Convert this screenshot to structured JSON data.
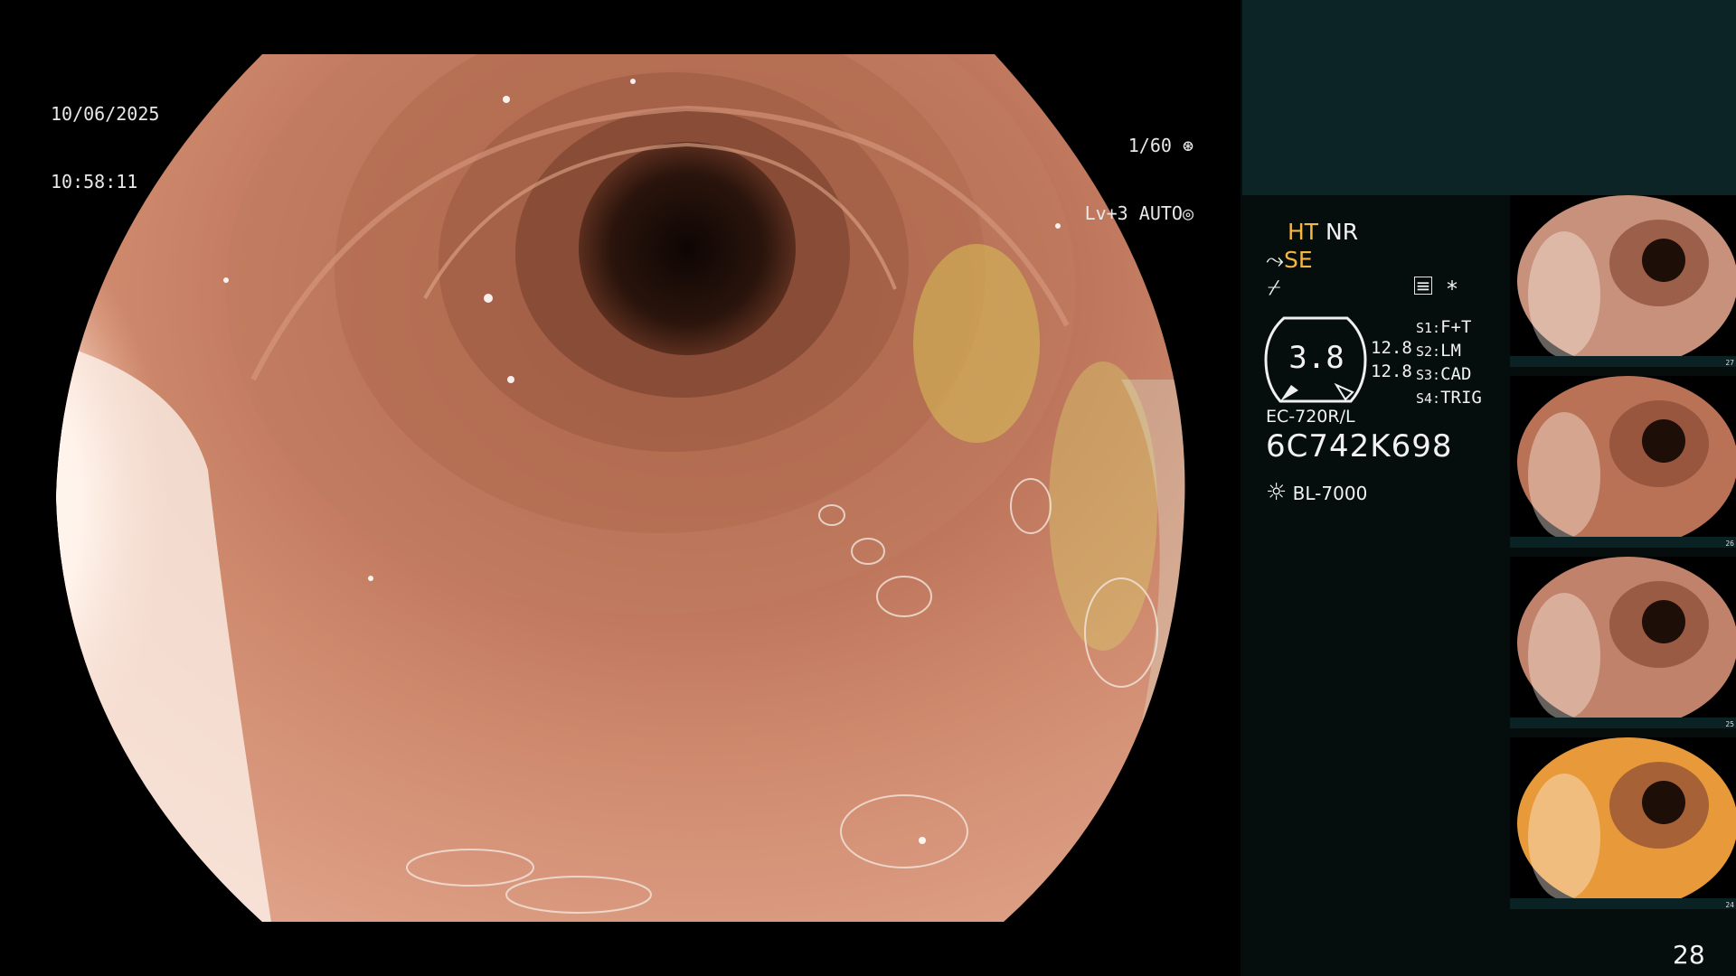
{
  "overlay": {
    "date": "10/06/2025",
    "time": "10:58:11",
    "shutter": "1/60",
    "level": "Lv+3",
    "iris": "AUTO"
  },
  "panel": {
    "ht": "HT",
    "nr": "NR",
    "se": "SE",
    "gauge_value": "3.8",
    "gauge_side_1": "12.8",
    "gauge_side_2": "12.8",
    "s1_label": "S1:",
    "s1_value": "F+T",
    "s2_label": "S2:",
    "s2_value": "LM",
    "s3_label": "S3:",
    "s3_value": "CAD",
    "s4_label": "S4:",
    "s4_value": "TRIG",
    "asterisk": "*",
    "scope_model": "EC-720R/L",
    "scope_serial": "6C742K698",
    "light_source": "BL-7000",
    "frame_number": "28"
  },
  "thumbnails": [
    {
      "num": "27",
      "tone": "#c7917c"
    },
    {
      "num": "26",
      "tone": "#b97256"
    },
    {
      "num": "25",
      "tone": "#c0826a"
    },
    {
      "num": "24",
      "tone": "#e89a3a"
    }
  ],
  "colors": {
    "mucosa": "#c98268",
    "lumen": "#1a0c08",
    "accent_orange": "#f5b642",
    "panel_band": "#0c2426"
  }
}
